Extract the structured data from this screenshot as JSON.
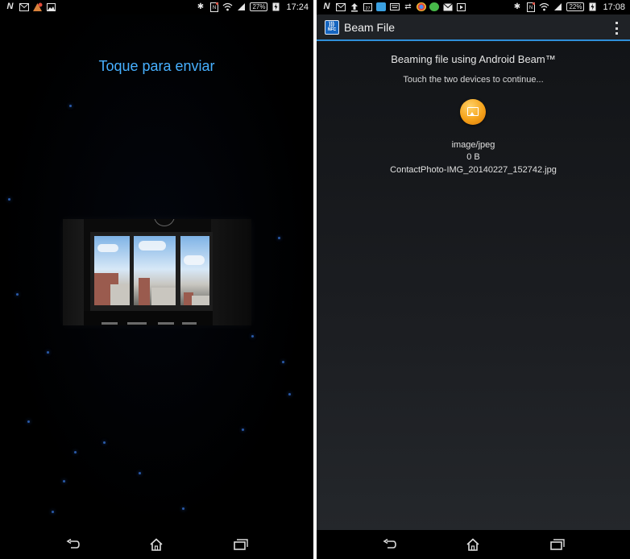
{
  "left_phone": {
    "status_bar": {
      "left_icons": [
        "nfc-n-icon",
        "gmail-icon",
        "app-notification-icon",
        "image-icon"
      ],
      "right_icons": [
        "bluetooth-icon",
        "nfc-status-icon",
        "wifi-icon",
        "signal-icon"
      ],
      "battery_percent": "27%",
      "time": "17:24"
    },
    "message": "Toque para enviar",
    "nav": [
      "back-icon",
      "home-icon",
      "recent-apps-icon"
    ]
  },
  "right_phone": {
    "status_bar": {
      "left_icons": [
        "nfc-n-icon",
        "gmail-icon",
        "upload-icon",
        "calendar-icon",
        "app-icon",
        "keyboard-icon",
        "shuffle-icon",
        "chrome-icon",
        "whatsapp-icon",
        "email-icon",
        "play-icon"
      ],
      "right_icons": [
        "bluetooth-icon",
        "nfc-status-icon",
        "wifi-icon",
        "signal-icon"
      ],
      "battery_percent": "22%",
      "time": "17:08"
    },
    "app_bar": {
      "logo_text": "NFC",
      "title": "Beam File"
    },
    "heading": "Beaming file using Android Beam™",
    "subheading": "Touch the two devices to continue...",
    "file": {
      "mime_type": "image/jpeg",
      "size": "0 B",
      "name": "ContactPhoto-IMG_20140227_152742.jpg"
    },
    "nav": [
      "back-icon",
      "home-icon",
      "recent-apps-icon"
    ]
  }
}
